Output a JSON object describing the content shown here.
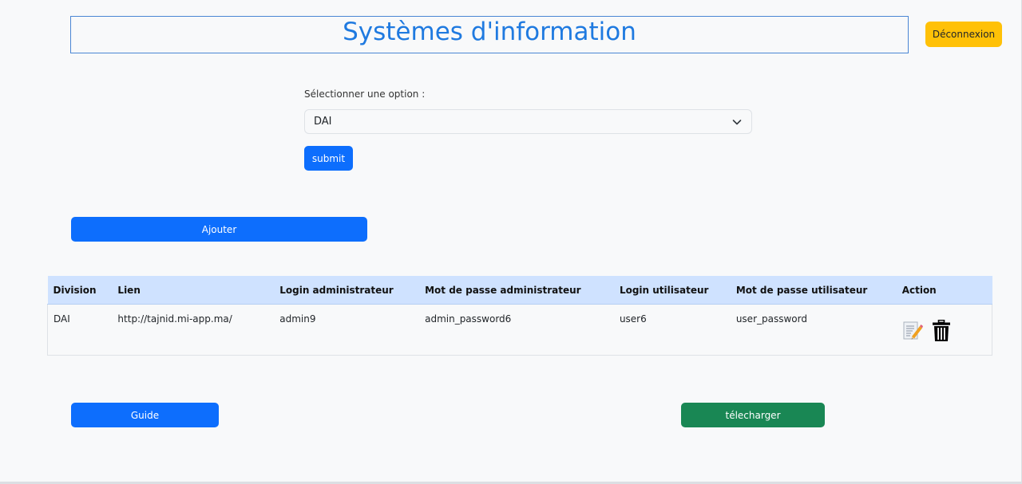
{
  "header": {
    "title": "Systèmes d'information",
    "logout_label": "Déconnexion"
  },
  "selector": {
    "label": "Sélectionner une option :",
    "selected_value": "DAI",
    "submit_label": "submit"
  },
  "add_label": "Ajouter",
  "table": {
    "columns": [
      "Division",
      "Lien",
      "Login administrateur",
      "Mot de passe administrateur",
      "Login utilisateur",
      "Mot de passe utilisateur",
      "Action"
    ],
    "rows": [
      {
        "division": "DAI",
        "lien": "http://tajnid.mi-app.ma/",
        "login_admin": "admin9",
        "password_admin": "admin_password6",
        "login_user": "user6",
        "password_user": "user_password",
        "actions": [
          "edit-icon",
          "trash-icon"
        ]
      }
    ]
  },
  "footer": {
    "guide_label": "Guide",
    "download_label": "télecharger"
  },
  "colors": {
    "primary": "#0d6efd",
    "warning": "#ffc107",
    "success": "#198754",
    "title": "#1f7ae0",
    "table_header_bg": "#cfe2ff",
    "page_bg": "#f8f9fa"
  }
}
